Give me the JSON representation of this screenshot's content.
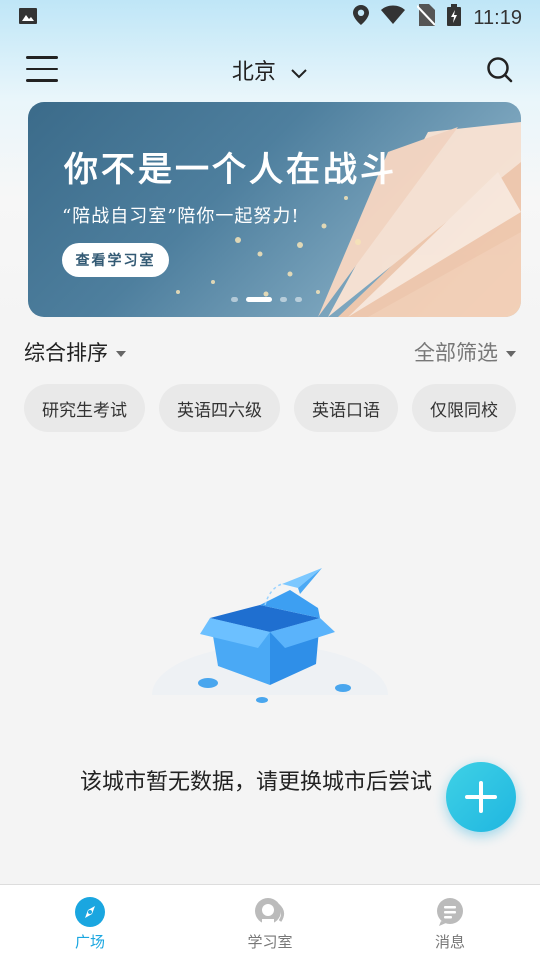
{
  "status_bar": {
    "time": "11:19"
  },
  "header": {
    "city": "北京"
  },
  "banner": {
    "title": "你不是一个人在战斗",
    "subtitle": "“陪战自习室”陪你一起努力!",
    "button_label": "查看学习室"
  },
  "filters": {
    "sort_label": "综合排序",
    "filter_label": "全部筛选"
  },
  "tags": [
    "研究生考试",
    "英语四六级",
    "英语口语",
    "仅限同校"
  ],
  "empty_message": "该城市暂无数据，请更换城市后尝试",
  "tabbar": {
    "items": [
      {
        "label": "广场"
      },
      {
        "label": "学习室"
      },
      {
        "label": "消息"
      }
    ]
  },
  "colors": {
    "accent": "#1aa6e0"
  }
}
